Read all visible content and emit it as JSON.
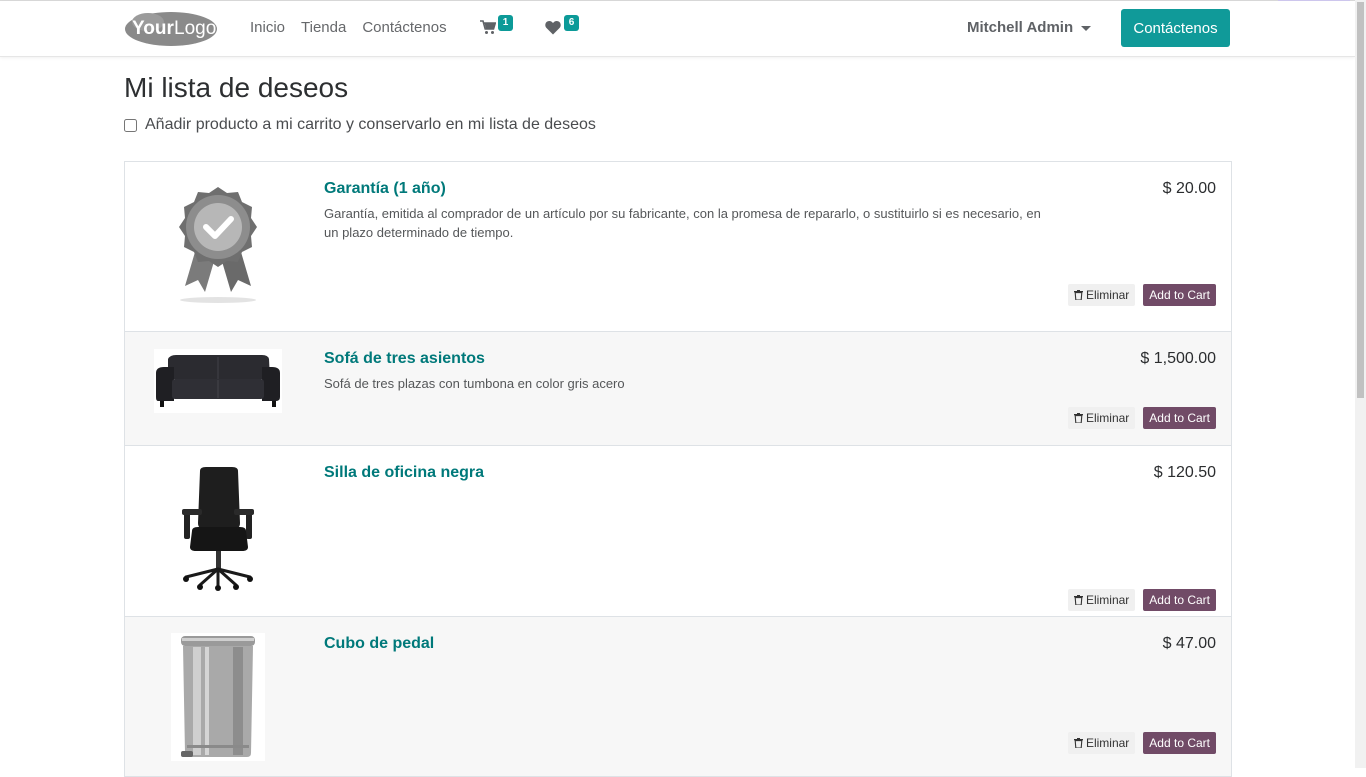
{
  "header": {
    "logo_text": "YourLogo",
    "nav": [
      "Inicio",
      "Tienda",
      "Contáctenos"
    ],
    "cart_count": "1",
    "wishlist_count": "6",
    "user_name": "Mitchell Admin",
    "contact_button": "Contáctenos"
  },
  "page": {
    "title": "Mi lista de deseos",
    "keep_in_wishlist_label": "Añadir producto a mi carrito y conservarlo en mi lista de deseos"
  },
  "items": [
    {
      "name": "Garantía (1 año)",
      "description": "Garantía, emitida al comprador de un artículo por su fabricante, con la promesa de repararlo, o sustituirlo si es necesario, en un plazo determinado de tiempo.",
      "price": "$ 20.00",
      "image": "warranty-badge",
      "remove_label": "Eliminar",
      "add_label": "Add to Cart"
    },
    {
      "name": "Sofá de tres asientos",
      "description": "Sofá de tres plazas con tumbona en color gris acero",
      "price": "$ 1,500.00",
      "image": "sofa",
      "remove_label": "Eliminar",
      "add_label": "Add to Cart"
    },
    {
      "name": "Silla de oficina negra",
      "description": "",
      "price": "$ 120.50",
      "image": "office-chair",
      "remove_label": "Eliminar",
      "add_label": "Add to Cart"
    },
    {
      "name": "Cubo de pedal",
      "description": "",
      "price": "$ 47.00",
      "image": "pedal-bin",
      "remove_label": "Eliminar",
      "add_label": "Add to Cart"
    }
  ],
  "colors": {
    "primary": "#109a99",
    "product_link": "#00797a",
    "add_to_cart": "#714b67"
  }
}
